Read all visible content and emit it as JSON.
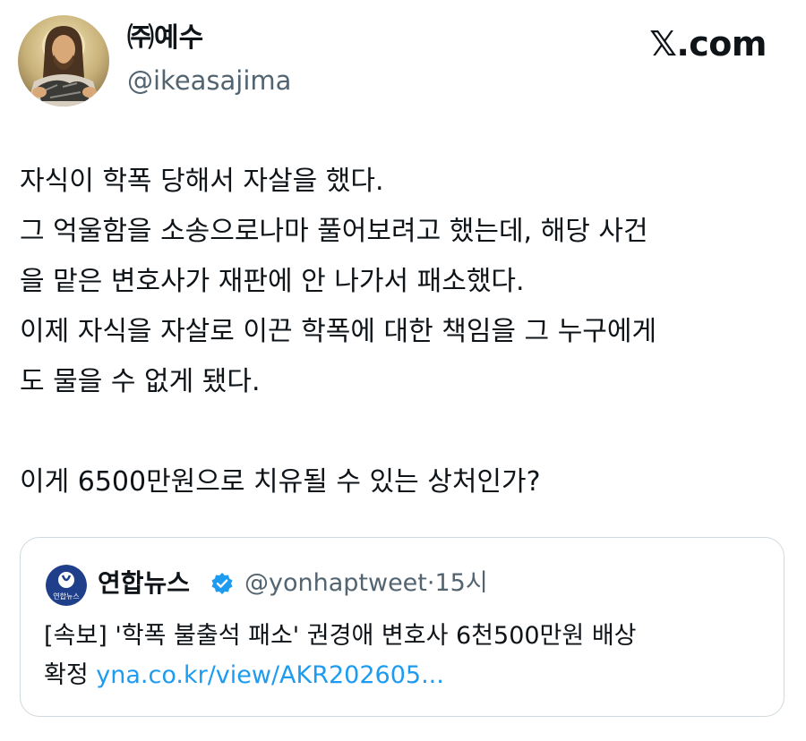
{
  "author": {
    "display_name": "㈜예수",
    "handle": "@ikeasajima",
    "avatar": "jesus-portrait-avatar"
  },
  "brand": {
    "label": "𝕏.com"
  },
  "tweet": {
    "lines": [
      "자식이 학폭 당해서 자살을 했다.",
      "그 억울함을 소송으로나마 풀어보려고 했는데, 해당 사건",
      "을 맡은 변호사가 재판에 안 나가서 패소했다.",
      "이제 자식을 자살로 이끈 학폭에 대한 책임을 그 누구에게",
      "도 물을 수 없게 됐다.",
      "",
      "이게 6500만원으로 치유될 수 있는 상처인가?"
    ]
  },
  "quote": {
    "display_name": "연합뉴스",
    "verified": true,
    "avatar_label": "연합뉴스",
    "handle": "@yonhaptweet",
    "separator": "·",
    "time": "15시",
    "text_line1": "[속보] '학폭 불출석 패소' 권경애 변호사 6천500만원 배상",
    "text_line2_prefix": "확정 ",
    "link": "yna.co.kr/view/AKR202605..."
  },
  "colors": {
    "text": "#0f1419",
    "secondary": "#536471",
    "link": "#1d9bf0",
    "verified": "#1d9bf0",
    "border": "#cfd9de"
  }
}
